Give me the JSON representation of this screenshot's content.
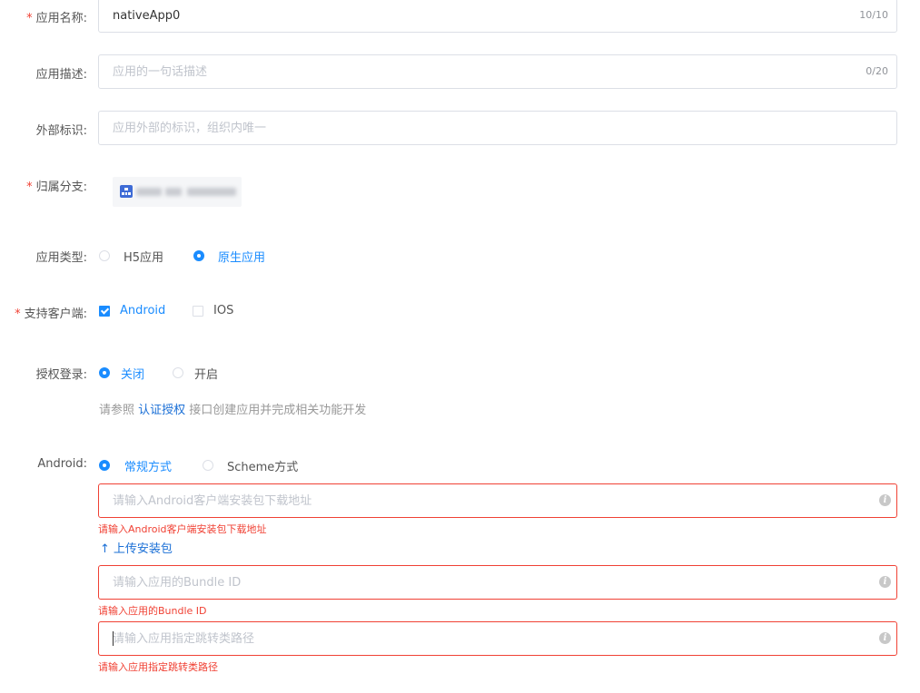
{
  "form": {
    "app_name": {
      "label": "应用名称:",
      "required": "*",
      "value": "nativeApp0",
      "count": "10/10"
    },
    "app_desc": {
      "label": "应用描述:",
      "placeholder": "应用的一句话描述",
      "count": "0/20"
    },
    "external_id": {
      "label": "外部标识:",
      "placeholder": "应用外部的标识，组织内唯一"
    },
    "branch": {
      "label": "归属分支:",
      "required": "*",
      "icon": "org-tree-icon"
    },
    "app_type": {
      "label": "应用类型:",
      "options": [
        "H5应用",
        "原生应用"
      ],
      "selected": "原生应用"
    },
    "clients": {
      "label": "支持客户端:",
      "required": "*",
      "options": [
        "Android",
        "IOS"
      ],
      "checked": [
        "Android"
      ]
    },
    "auth_login": {
      "label": "授权登录:",
      "options": [
        "关闭",
        "开启"
      ],
      "selected": "关闭",
      "hint_prefix": "请参照 ",
      "hint_link": "认证授权",
      "hint_suffix": " 接口创建应用并完成相关功能开发"
    },
    "android": {
      "label": "Android:",
      "modes": [
        "常规方式",
        "Scheme方式"
      ],
      "selected": "常规方式",
      "download_url": {
        "placeholder": "请输入Android客户端安装包下载地址",
        "error": "请输入Android客户端安装包下载地址"
      },
      "upload_label": "上传安装包",
      "bundle_id": {
        "placeholder": "请输入应用的Bundle ID",
        "error": "请输入应用的Bundle ID"
      },
      "jump_path": {
        "placeholder": "请输入应用指定跳转类路径",
        "error": "请输入应用指定跳转类路径"
      }
    }
  },
  "colors": {
    "primary": "#1a8cff",
    "error": "#f04134",
    "border": "#dcdfe6"
  }
}
